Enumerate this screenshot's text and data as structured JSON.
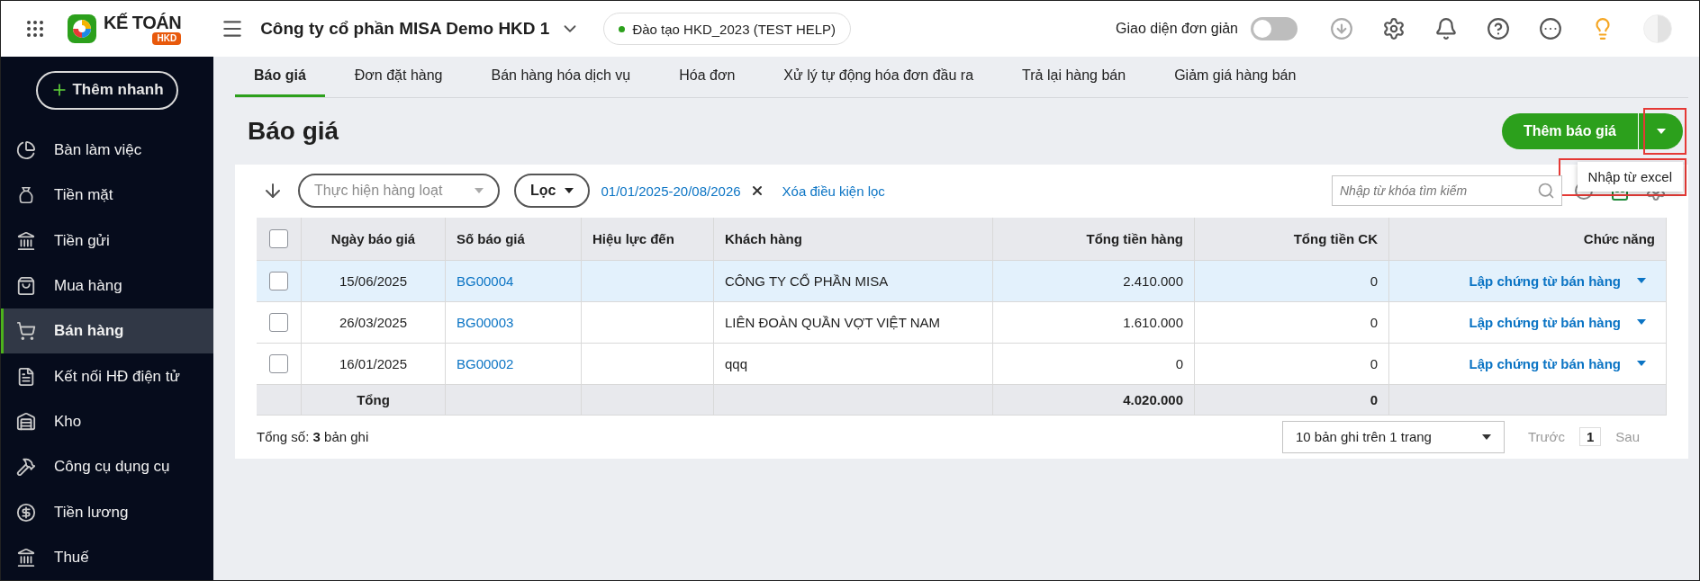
{
  "topbar": {
    "brand": "KẾ TOÁN",
    "brand_badge": "HKD",
    "company": "Công ty cổ phần MISA Demo HKD 1",
    "database": {
      "label": "Đào tạo HKD_2023 (TEST HELP)",
      "color": "#2ca01c"
    },
    "simple_mode": {
      "label": "Giao diện đơn giản",
      "on": false
    }
  },
  "sidebar": {
    "quick_add": "Thêm nhanh",
    "items": [
      {
        "label": "Bàn làm việc",
        "selected": false
      },
      {
        "label": "Tiền mặt",
        "selected": false
      },
      {
        "label": "Tiền gửi",
        "selected": false
      },
      {
        "label": "Mua hàng",
        "selected": false
      },
      {
        "label": "Bán hàng",
        "selected": true
      },
      {
        "label": "Kết nối HĐ điện tử",
        "selected": false
      },
      {
        "label": "Kho",
        "selected": false
      },
      {
        "label": "Công cụ dụng cụ",
        "selected": false
      },
      {
        "label": "Tiền lương",
        "selected": false
      },
      {
        "label": "Thuế",
        "selected": false
      }
    ]
  },
  "tabs": [
    {
      "label": "Báo giá",
      "selected": true
    },
    {
      "label": "Đơn đặt hàng",
      "selected": false
    },
    {
      "label": "Bán hàng hóa dịch vụ",
      "selected": false
    },
    {
      "label": "Hóa đơn",
      "selected": false
    },
    {
      "label": "Xử lý tự động hóa đơn đầu ra",
      "selected": false
    },
    {
      "label": "Trả lại hàng bán",
      "selected": false
    },
    {
      "label": "Giảm giá hàng bán",
      "selected": false
    }
  ],
  "page_title": "Báo giá",
  "primary_action": {
    "label": "Thêm báo giá",
    "menu_items": [
      "Nhập từ excel"
    ]
  },
  "toolbar": {
    "bulk_action": "Thực hiện hàng loạt",
    "filter": "Lọc",
    "date_range": "01/01/2025-20/08/2026",
    "clear_filter": "Xóa điều kiện lọc",
    "search": {
      "placeholder": "Nhập từ khóa tìm kiếm"
    }
  },
  "table": {
    "all_checked": false,
    "columns": [
      "Ngày báo giá",
      "Số báo giá",
      "Hiệu lực đến",
      "Khách hàng",
      "Tổng tiền hàng",
      "Tổng tiền CK",
      "Chức năng"
    ],
    "rows": [
      {
        "selected": true,
        "checked": false,
        "cells": [
          "15/06/2025",
          "BG00004",
          "",
          "CÔNG TY CỔ PHẦN MISA",
          "2.410.000",
          "0"
        ],
        "action": "Lập chứng từ bán hàng"
      },
      {
        "selected": false,
        "checked": false,
        "cells": [
          "26/03/2025",
          "BG00003",
          "",
          "LIÊN ĐOÀN QUẦN VỢT VIỆT NAM",
          "1.610.000",
          "0"
        ],
        "action": "Lập chứng từ bán hàng"
      },
      {
        "selected": false,
        "checked": false,
        "cells": [
          "16/01/2025",
          "BG00002",
          "",
          "qqq",
          "0",
          "0"
        ],
        "action": "Lập chứng từ bán hàng"
      }
    ],
    "totals": {
      "label": "Tổng",
      "total_goods": "4.020.000",
      "total_discount": "0"
    }
  },
  "footer": {
    "count": "Tổng số: **3** bản ghi",
    "page_size": "10 bản ghi trên 1 trang",
    "prev": "Trước",
    "page": "1",
    "next": "Sau"
  }
}
